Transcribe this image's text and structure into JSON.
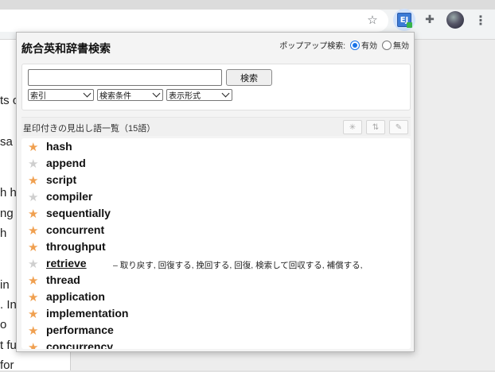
{
  "browser": {
    "icons": {
      "bookmark": "☆",
      "extensions": "✚",
      "menu": "⋮"
    },
    "extension_logo_text": "EJ"
  },
  "background_page": {
    "fragments": [
      "ts o",
      "sa",
      "h h",
      "ng",
      "h",
      "in",
      ". In",
      "o",
      "t fu",
      "for"
    ]
  },
  "popup": {
    "title": "統合英和辞書検索",
    "popup_search_label": "ポップアップ検索:",
    "option_enabled": "有効",
    "option_disabled": "無効",
    "selected_option": "有効",
    "search": {
      "value": "",
      "button_label": "検索",
      "selects": [
        "索引",
        "検索条件",
        "表示形式"
      ]
    },
    "list_title": "星印付きの見出し語一覧（15語）",
    "header_buttons": {
      "star": "✳",
      "sort": "⇅",
      "edit": "✎"
    },
    "colors": {
      "star_on": "#f0a050",
      "star_off": "#cfcfcf"
    },
    "items": [
      {
        "word": "hash",
        "starred": true
      },
      {
        "word": "append",
        "starred": false
      },
      {
        "word": "script",
        "starred": true
      },
      {
        "word": "compiler",
        "starred": false
      },
      {
        "word": "sequentially",
        "starred": true
      },
      {
        "word": "concurrent",
        "starred": true
      },
      {
        "word": "throughput",
        "starred": true
      },
      {
        "word": "retrieve",
        "starred": false,
        "selected": true,
        "definition": "– 取り戻す, 回復する, 挽回する, 回復, 検索して回収する, 補償する,"
      },
      {
        "word": "thread",
        "starred": true
      },
      {
        "word": "application",
        "starred": true
      },
      {
        "word": "implementation",
        "starred": true
      },
      {
        "word": "performance",
        "starred": true
      },
      {
        "word": "concurrency",
        "starred": true
      }
    ]
  }
}
